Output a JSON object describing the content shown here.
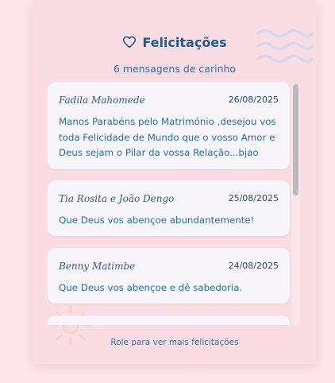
{
  "section": {
    "title": "Felicitações",
    "subtitle": "6 mensagens de carinho",
    "footer_hint": "Role para ver mais felicitações"
  },
  "icons": {
    "title_icon": "heart-icon",
    "decor_top": "waves-icon",
    "decor_bottom": "sun-icon"
  },
  "colors": {
    "accent": "#1f5a93",
    "card_bg": "#fadde3",
    "message_bg": "#f8f6fa"
  },
  "messages": [
    {
      "name": "Fadila Mahomede",
      "date": "26/08/2025",
      "text": "Manos Parabéns pelo Matrimónio ,desejou vos toda Felicidade de Mundo que o vosso Amor e Deus sejam o Pilar da vossa Relação...bjao"
    },
    {
      "name": "Tia Rosita e João Dengo",
      "date": "25/08/2025",
      "text": "Que Deus vos abençoe abundantemente!"
    },
    {
      "name": "Benny Matimbe",
      "date": "24/08/2025",
      "text": "Que Deus vos abençoe e dê sabedoria."
    }
  ]
}
